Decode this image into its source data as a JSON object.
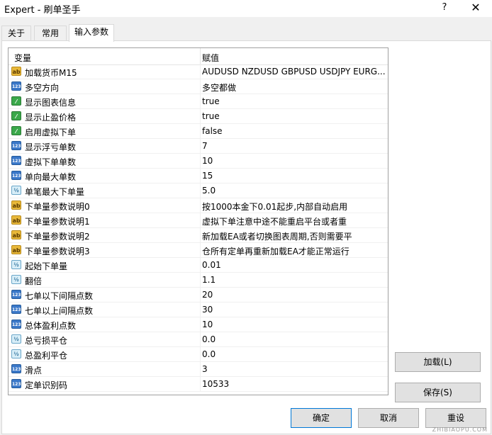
{
  "window": {
    "title": "Expert - 刷单圣手",
    "help_label": "?",
    "close_label": "✕"
  },
  "tabs": [
    {
      "label": "关于"
    },
    {
      "label": "常用"
    },
    {
      "label": "输入参数"
    }
  ],
  "grid": {
    "header": {
      "col1": "变量",
      "col2": "赋值"
    },
    "rows": [
      {
        "type": "ab",
        "name": "加载货币M15",
        "value": "AUDUSD NZDUSD GBPUSD USDJPY EURG..."
      },
      {
        "type": "123",
        "name": "多空方向",
        "value": "多空都做"
      },
      {
        "type": "bool",
        "name": "显示图表信息",
        "value": "true"
      },
      {
        "type": "bool",
        "name": "显示止盈价格",
        "value": "true"
      },
      {
        "type": "bool",
        "name": "启用虚拟下单",
        "value": "false"
      },
      {
        "type": "123",
        "name": "显示浮亏单数",
        "value": "7"
      },
      {
        "type": "123",
        "name": "虚拟下单单数",
        "value": "10"
      },
      {
        "type": "123",
        "name": "单向最大单数",
        "value": "15"
      },
      {
        "type": "dbl",
        "name": "单笔最大下单量",
        "value": "5.0"
      },
      {
        "type": "ab",
        "name": "下单量参数说明0",
        "value": "按1000本金下0.01起步,内部自动启用"
      },
      {
        "type": "ab",
        "name": "下单量参数说明1",
        "value": "虚拟下单注意中途不能重启平台或者重"
      },
      {
        "type": "ab",
        "name": "下单量参数说明2",
        "value": "新加载EA或者切换图表周期,否则需要平"
      },
      {
        "type": "ab",
        "name": "下单量参数说明3",
        "value": "仓所有定单再重新加载EA才能正常运行"
      },
      {
        "type": "dbl",
        "name": "起始下单量",
        "value": "0.01"
      },
      {
        "type": "dbl",
        "name": "翻倍",
        "value": "1.1"
      },
      {
        "type": "123",
        "name": "七单以下间隔点数",
        "value": "20"
      },
      {
        "type": "123",
        "name": "七单以上间隔点数",
        "value": "30"
      },
      {
        "type": "123",
        "name": "总体盈利点数",
        "value": "10"
      },
      {
        "type": "dbl",
        "name": "总亏损平仓",
        "value": "0.0"
      },
      {
        "type": "dbl",
        "name": "总盈利平仓",
        "value": "0.0"
      },
      {
        "type": "123",
        "name": "滑点",
        "value": "3"
      },
      {
        "type": "123",
        "name": "定单识别码",
        "value": "10533"
      }
    ]
  },
  "icon_labels": {
    "ab": "ab",
    "123": "123",
    "bool": "⁄",
    "dbl": "½"
  },
  "buttons": {
    "load": "加载(L)",
    "save": "保存(S)",
    "ok": "确定",
    "cancel": "取消",
    "reset": "重设"
  },
  "watermark": "ZHIBIAOPU.COM"
}
